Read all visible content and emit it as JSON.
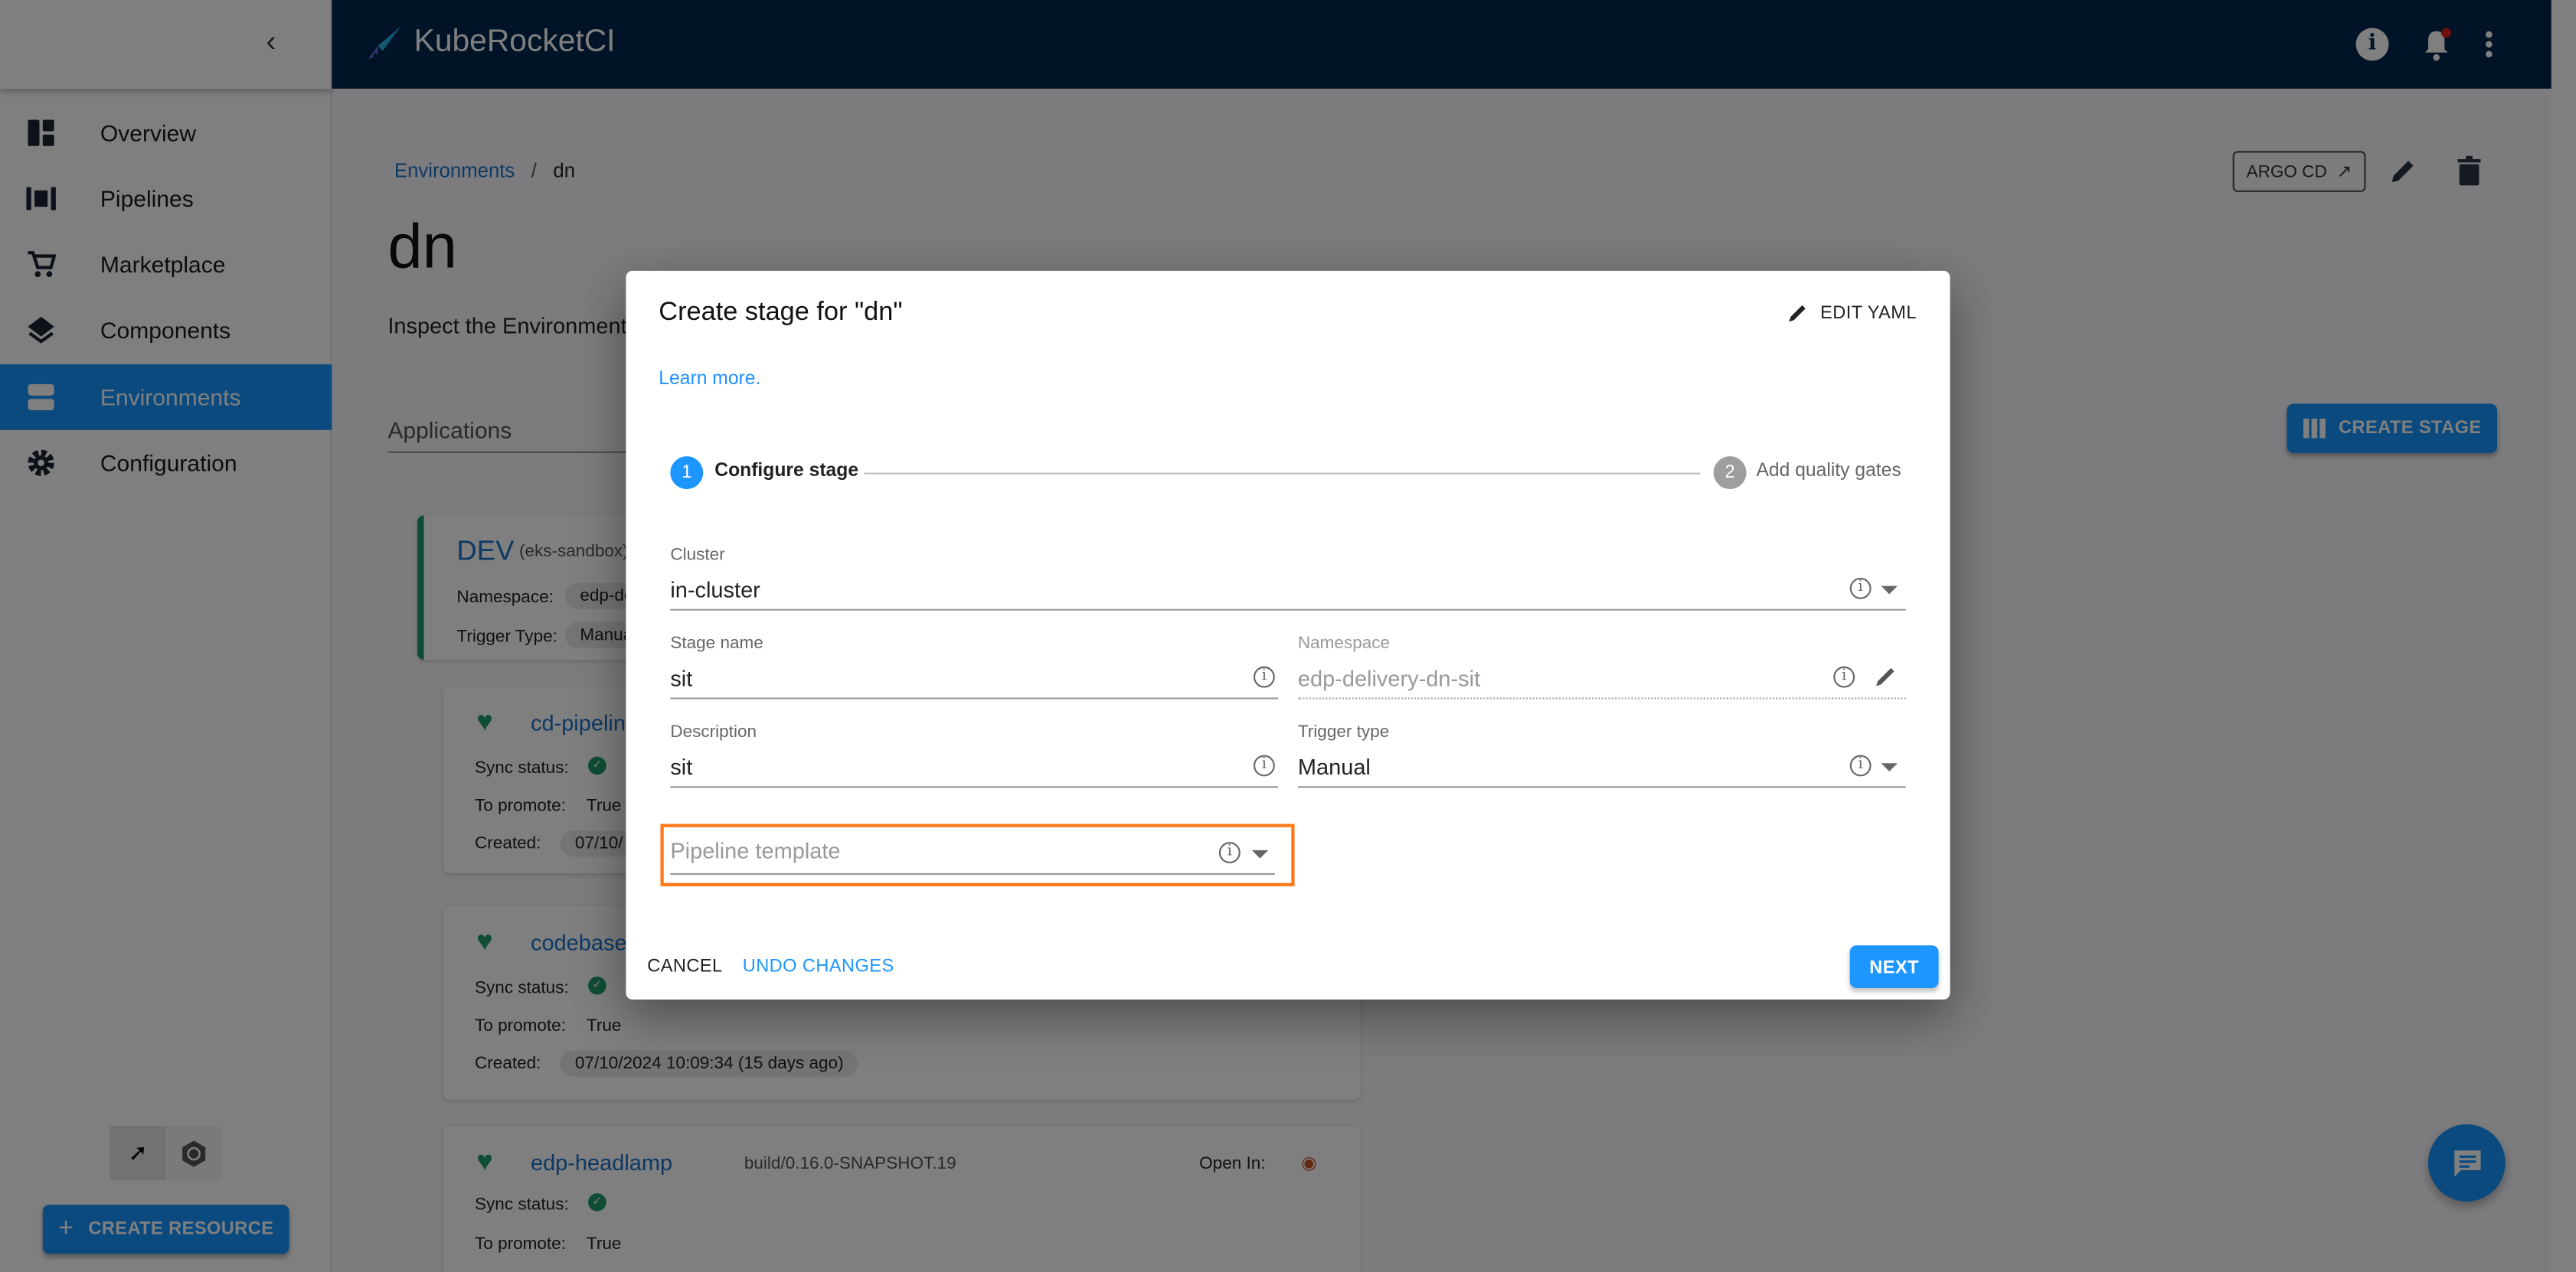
{
  "app": {
    "name": "KubeRocketCI"
  },
  "sidebar": {
    "items": [
      {
        "label": "Overview",
        "icon": "dashboard-icon"
      },
      {
        "label": "Pipelines",
        "icon": "pipelines-icon"
      },
      {
        "label": "Marketplace",
        "icon": "cart-icon"
      },
      {
        "label": "Components",
        "icon": "layers-icon"
      },
      {
        "label": "Environments",
        "icon": "environments-icon",
        "selected": true
      },
      {
        "label": "Configuration",
        "icon": "gear-icon"
      }
    ],
    "create_resource": "CREATE RESOURCE"
  },
  "breadcrumb": {
    "parent": "Environments",
    "separator": "/",
    "current": "dn"
  },
  "page": {
    "title": "dn",
    "description": "Inspect the Environment",
    "tab": "Applications",
    "argo_cd": "ARGO CD",
    "create_stage": "CREATE STAGE"
  },
  "stage_card": {
    "name": "DEV",
    "cluster": "(eks-sandbox)",
    "namespace_label": "Namespace:",
    "namespace_value": "edp-de",
    "trigger_label": "Trigger Type:",
    "trigger_value": "Manua"
  },
  "apps": [
    {
      "name": "cd-pipelin",
      "sync_label": "Sync status:",
      "promote_label": "To promote:",
      "promote": "True",
      "created_label": "Created:",
      "created": "07/10/"
    },
    {
      "name": "codebase",
      "sync_label": "Sync status:",
      "promote_label": "To promote:",
      "promote": "True",
      "created_label": "Created:",
      "created": "07/10/2024 10:09:34 (15 days ago)"
    },
    {
      "name": "edp-headlamp",
      "version": "build/0.16.0-SNAPSHOT.19",
      "open_in": "Open In:",
      "sync_label": "Sync status:",
      "promote_label": "To promote:",
      "promote": "True"
    }
  ],
  "modal": {
    "title": "Create stage for \"dn\"",
    "edit_yaml": "EDIT YAML",
    "learn_more": "Learn more.",
    "steps": [
      {
        "num": "1",
        "label": "Configure stage",
        "active": true
      },
      {
        "num": "2",
        "label": "Add quality gates",
        "active": false
      }
    ],
    "fields": {
      "cluster": {
        "label": "Cluster",
        "value": "in-cluster"
      },
      "stage_name": {
        "label": "Stage name",
        "value": "sit"
      },
      "namespace": {
        "label": "Namespace",
        "value": "edp-delivery-dn-sit"
      },
      "description": {
        "label": "Description",
        "value": "sit"
      },
      "trigger_type": {
        "label": "Trigger type",
        "value": "Manual"
      },
      "pipeline_template": {
        "placeholder": "Pipeline template"
      }
    },
    "cancel": "CANCEL",
    "undo": "UNDO CHANGES",
    "next": "NEXT"
  },
  "colors": {
    "accent": "#1e96ff",
    "header": "#00274f",
    "highlight": "#ff7a1a",
    "healthy": "#1f9d6b"
  }
}
